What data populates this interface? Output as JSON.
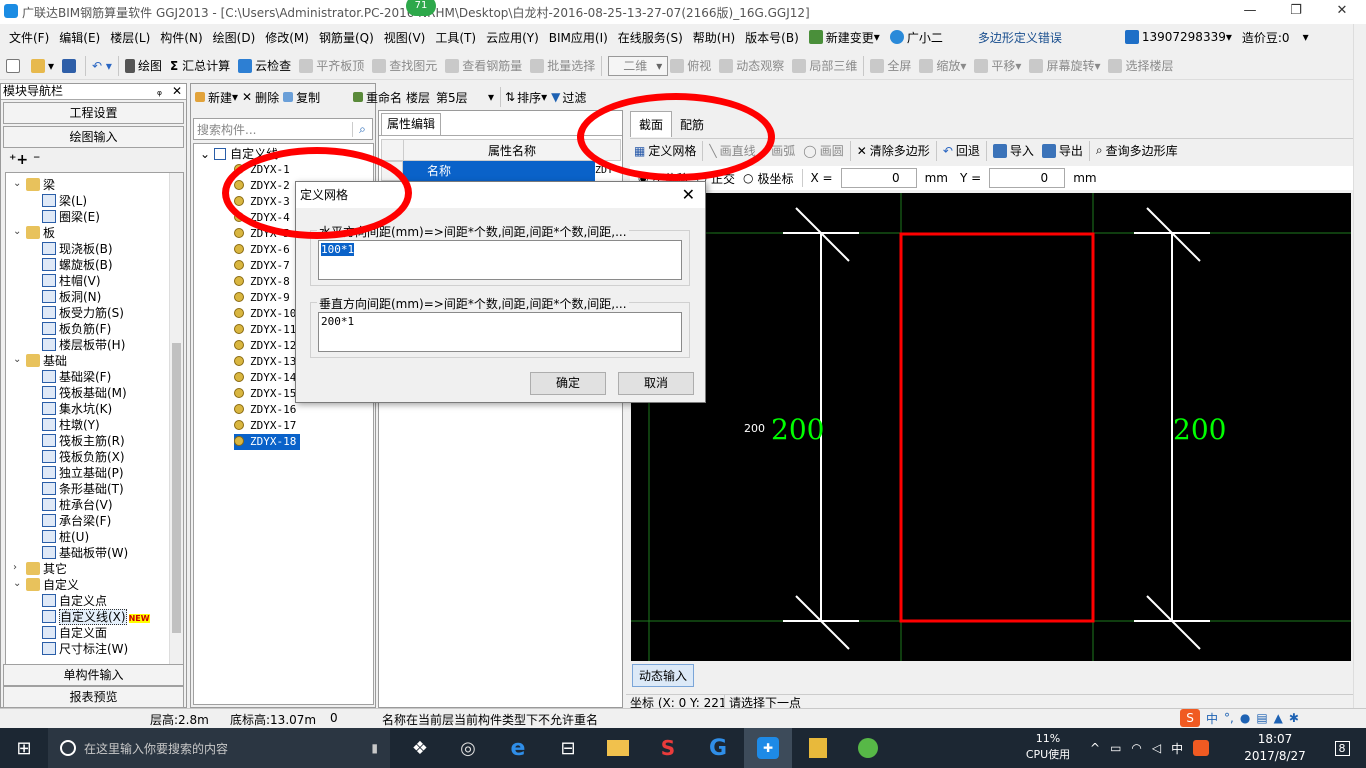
{
  "titlebar": {
    "text": "广联达BIM钢筋算量软件 GGJ2013 - [C:\\Users\\Administrator.PC-2016         NRHM\\Desktop\\白龙村-2016-08-25-13-27-07(2166版)_16G.GGJ12]",
    "badge": "71",
    "minimize": "—",
    "restore": "❐",
    "close": "✕"
  },
  "menubar": {
    "items": [
      "文件(F)",
      "编辑(E)",
      "楼层(L)",
      "构件(N)",
      "绘图(D)",
      "修改(M)",
      "钢筋量(Q)",
      "视图(V)",
      "工具(T)",
      "云应用(Y)",
      "BIM应用(I)",
      "在线服务(S)",
      "帮助(H)",
      "版本号(B)"
    ],
    "new_change": "新建变更",
    "assistant": "广小二",
    "error_msg": "多边形定义错误",
    "phone": "13907298339",
    "price": "造价豆:0"
  },
  "toolbar1": {
    "draw": "绘图",
    "sum": "汇总计算",
    "cloud_check": "云检查",
    "align_slab": "平齐板顶",
    "find_element": "查找图元",
    "view_rebar": "查看钢筋量",
    "batch_select": "批量选择",
    "view_mode": "二维",
    "top_view": "俯视",
    "dynamic_observe": "动态观察",
    "local_3d": "局部三维",
    "fullscreen": "全屏",
    "zoom": "缩放",
    "pan": "平移",
    "screen_rotate": "屏幕旋转",
    "select_floor": "选择楼层"
  },
  "leftpanel": {
    "title": "模块导航栏",
    "pin": "ᵩ",
    "close": "✕",
    "btn_project": "工程设置",
    "btn_draw_input": "绘图输入",
    "btn_single": "单构件输入",
    "btn_report": "报表预览",
    "tree": [
      {
        "label": "梁",
        "level": 0,
        "expand": "⌄"
      },
      {
        "label": "梁(L)",
        "level": 1
      },
      {
        "label": "圈梁(E)",
        "level": 1
      },
      {
        "label": "板",
        "level": 0,
        "expand": "⌄"
      },
      {
        "label": "现浇板(B)",
        "level": 1
      },
      {
        "label": "螺旋板(B)",
        "level": 1
      },
      {
        "label": "柱帽(V)",
        "level": 1
      },
      {
        "label": "板洞(N)",
        "level": 1
      },
      {
        "label": "板受力筋(S)",
        "level": 1
      },
      {
        "label": "板负筋(F)",
        "level": 1
      },
      {
        "label": "楼层板带(H)",
        "level": 1
      },
      {
        "label": "基础",
        "level": 0,
        "expand": "⌄"
      },
      {
        "label": "基础梁(F)",
        "level": 1
      },
      {
        "label": "筏板基础(M)",
        "level": 1
      },
      {
        "label": "集水坑(K)",
        "level": 1
      },
      {
        "label": "柱墩(Y)",
        "level": 1
      },
      {
        "label": "筏板主筋(R)",
        "level": 1
      },
      {
        "label": "筏板负筋(X)",
        "level": 1
      },
      {
        "label": "独立基础(P)",
        "level": 1
      },
      {
        "label": "条形基础(T)",
        "level": 1
      },
      {
        "label": "桩承台(V)",
        "level": 1
      },
      {
        "label": "承台梁(F)",
        "level": 1
      },
      {
        "label": "桩(U)",
        "level": 1
      },
      {
        "label": "基础板带(W)",
        "level": 1
      },
      {
        "label": "其它",
        "level": 0,
        "expand": "›"
      },
      {
        "label": "自定义",
        "level": 0,
        "expand": "⌄"
      },
      {
        "label": "自定义点",
        "level": 1
      },
      {
        "label": "自定义线(X)",
        "level": 1,
        "selected": true,
        "badge": "NEW"
      },
      {
        "label": "自定义面",
        "level": 1
      },
      {
        "label": "尺寸标注(W)",
        "level": 1
      }
    ]
  },
  "midpanel": {
    "new": "新建",
    "delete": "删除",
    "copy": "复制",
    "rename": "重命名",
    "floor_label": "楼层",
    "floor_value": "第5层",
    "sort": "排序",
    "filter": "过滤",
    "search_placeholder": "搜索构件...",
    "root": "自定义线",
    "items": [
      "ZDYX-1",
      "ZDYX-2",
      "ZDYX-3",
      "ZDYX-4",
      "ZDYX-5",
      "ZDYX-6",
      "ZDYX-7",
      "ZDYX-8",
      "ZDYX-9",
      "ZDYX-10",
      "ZDYX-11",
      "ZDYX-12",
      "ZDYX-13",
      "ZDYX-14",
      "ZDYX-15",
      "ZDYX-16",
      "ZDYX-17",
      "ZDYX-18"
    ],
    "selected": "ZDYX-18"
  },
  "proppanel": {
    "tab": "属性编辑",
    "col_name": "属性名称",
    "row_name": "名称",
    "row_value": "ZDY"
  },
  "rightpanel": {
    "tab_section": "截面",
    "tab_rebar": "配筋",
    "define_grid": "定义网格",
    "draw_line": "画直线",
    "draw_arc": "画弧",
    "draw_circle": "画圆",
    "clear_polygon": "清除多边形",
    "undo": "回退",
    "import": "导入",
    "export": "导出",
    "query_lib": "查询多边形库",
    "radio_no_offset": "不偏移",
    "radio_ortho": "正交",
    "radio_polar": "极坐标",
    "x_label": "X =",
    "x_value": "0",
    "x_unit": "mm",
    "y_label": "Y =",
    "y_value": "0",
    "y_unit": "mm",
    "dim_small": "200",
    "dim_left": "200",
    "dim_right": "200",
    "dynamic_input": "动态输入",
    "coord_text": "坐标 (X: 0 Y: 221)",
    "prompt": "请选择下一点"
  },
  "dialog": {
    "title": "定义网格",
    "h_label": "水平方向间距(mm)=>间距*个数,间距,间距*个数,间距,...",
    "h_value": "100*1",
    "v_label": "垂直方向间距(mm)=>间距*个数,间距,间距*个数,间距,...",
    "v_value": "200*1",
    "ok": "确定",
    "cancel": "取消"
  },
  "statusbar": {
    "floor_height": "层高:2.8m",
    "base_height": "底标高:13.07m",
    "zero": "0",
    "message": "名称在当前层当前构件类型下不允许重名"
  },
  "taskbar": {
    "search_placeholder": "在这里输入你要搜索的内容",
    "cpu_pct": "11%",
    "cpu_label": "CPU使用",
    "lang": "中",
    "time": "18:07",
    "date": "2017/8/27",
    "notify": "8"
  },
  "colors": {
    "dim_green": "#00ff00",
    "rect_red": "#ff0000",
    "annotation_red": "#ff0000",
    "selection_blue": "#0a62c9"
  }
}
